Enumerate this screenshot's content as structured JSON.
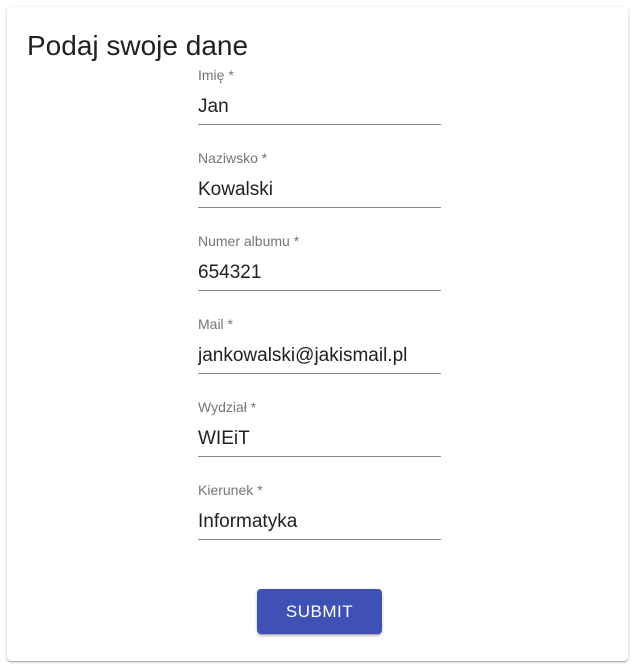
{
  "form": {
    "title": "Podaj swoje dane",
    "fields": [
      {
        "label": "Imię *",
        "value": "Jan"
      },
      {
        "label": "Naziwsko *",
        "value": "Kowalski"
      },
      {
        "label": "Numer albumu *",
        "value": "654321"
      },
      {
        "label": "Mail *",
        "value": "jankowalski@jakismail.pl"
      },
      {
        "label": "Wydział *",
        "value": "WIEiT"
      },
      {
        "label": "Kierunek *",
        "value": "Informatyka"
      }
    ],
    "submit_label": "SUBMIT"
  },
  "colors": {
    "primary": "#3f51b5",
    "label": "#757575",
    "text": "#212121",
    "underline": "#8a8a8a"
  }
}
